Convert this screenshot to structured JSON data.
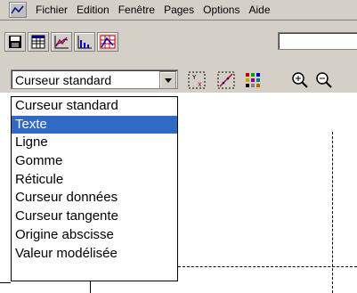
{
  "menubar": {
    "app_icon": "graph-window-icon",
    "items": [
      "Fichier",
      "Edition",
      "Fenêtre",
      "Pages",
      "Options",
      "Aide"
    ]
  },
  "toolbar1": {
    "buttons": [
      "save-icon",
      "table-icon",
      "curve-graph-icon",
      "bar-graph-icon",
      "grid-graph-icon"
    ],
    "input_value": ""
  },
  "toolbar2": {
    "select_value": "Curseur standard",
    "buttons": [
      "axes-xy-icon",
      "tangent-line-icon",
      "color-grid-icon",
      "zoom-in-icon",
      "zoom-out-icon"
    ]
  },
  "dropdown": {
    "selected_index": 1,
    "options": [
      "Curseur standard",
      "Texte",
      "Ligne",
      "Gomme",
      "Réticule",
      "Curseur données",
      "Curseur tangente",
      "Origine abscisse",
      "Valeur modélisée"
    ]
  },
  "colors": {
    "window_bg": "#d4d0c8",
    "selection": "#316ac5",
    "plot_bg": "#ffffff"
  }
}
